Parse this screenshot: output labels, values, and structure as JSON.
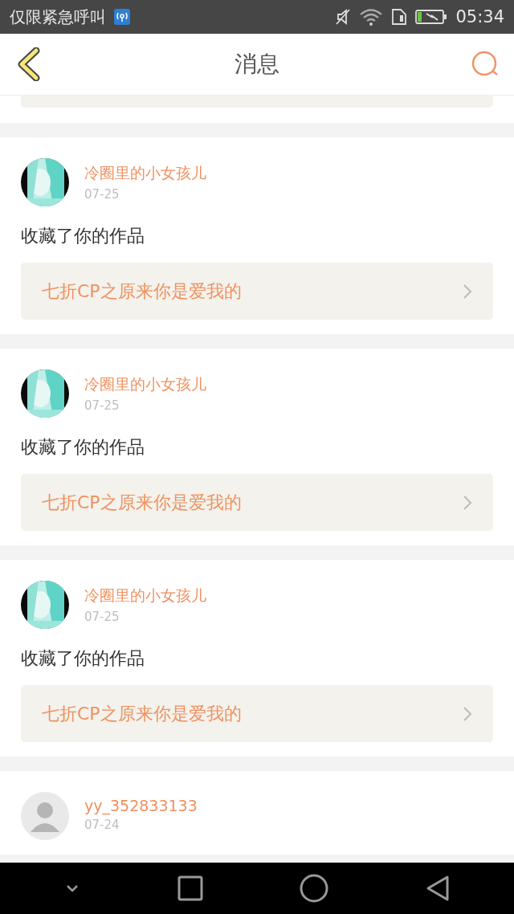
{
  "status_bar": {
    "carrier": "仅限紧急呼叫",
    "time": "05:34"
  },
  "header": {
    "title": "消息"
  },
  "messages": [
    {
      "user": "冷圈里的小女孩儿",
      "date": "07-25",
      "action": "收藏了你的作品",
      "work": "七折CP之原来你是爱我的"
    },
    {
      "user": "冷圈里的小女孩儿",
      "date": "07-25",
      "action": "收藏了你的作品",
      "work": "七折CP之原来你是爱我的"
    },
    {
      "user": "冷圈里的小女孩儿",
      "date": "07-25",
      "action": "收藏了你的作品",
      "work": "七折CP之原来你是爱我的"
    },
    {
      "avatar": {
        "kind": "silhouette"
      },
      "user": "yy_352833133",
      "date": "07-24"
    }
  ]
}
